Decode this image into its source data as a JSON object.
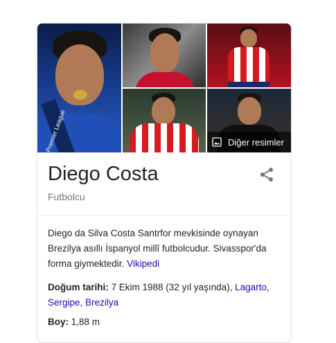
{
  "gallery": {
    "main_ribbon_text": "Premier League",
    "more_images_label": "Diğer resimler"
  },
  "entity": {
    "name": "Diego Costa",
    "subtitle": "Futbolcu"
  },
  "description": {
    "text": "Diego da Silva Costa Santrfor mevkisinde oynayan Brezilya asıllı İspanyol millî futbolcudur. Sivasspor'da forma giymektedir.",
    "source_link": "Vikipedi"
  },
  "facts": {
    "birth": {
      "label": "Doğum tarihi:",
      "value": "7 Ekim 1988 (32 yıl yaşında),",
      "link1": "Lagarto",
      "sep1": ",",
      "link2": "Sergipe",
      "sep2": ",",
      "link3": "Brezilya"
    },
    "height": {
      "label": "Boy:",
      "value": "1,88 m"
    }
  },
  "colors": {
    "link": "#1a0dab",
    "muted": "#70757a",
    "border": "#dfe1e5"
  },
  "icons": [
    "share-icon",
    "image-icon"
  ]
}
